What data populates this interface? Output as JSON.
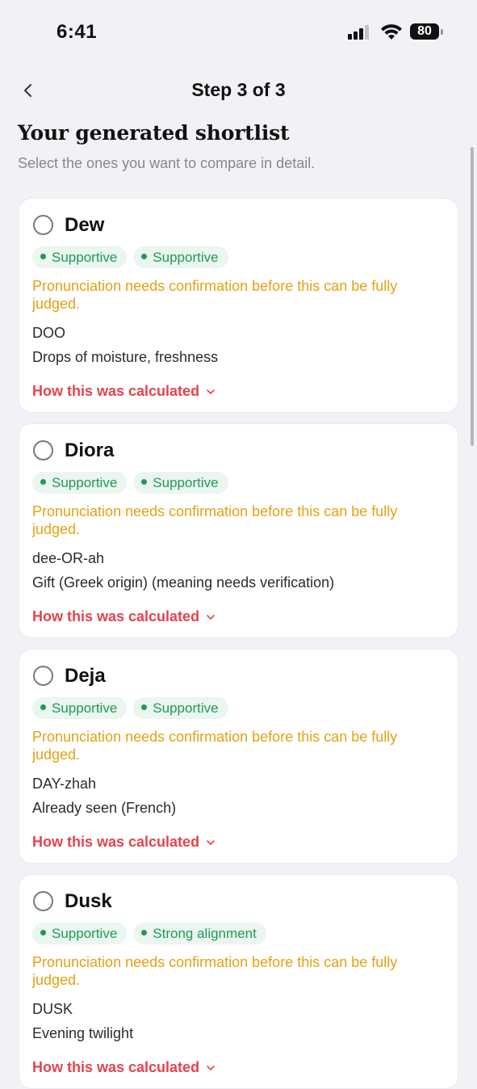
{
  "status_bar": {
    "time": "6:41",
    "battery": "80"
  },
  "header": {
    "step": "Step 3 of 3"
  },
  "page": {
    "title": "Your generated shortlist",
    "subtitle": "Select the ones you want to compare in detail."
  },
  "colors": {
    "accent_red": "#e5434d",
    "warning": "#e5a113",
    "badge_green": "#1f9a57"
  },
  "cards": [
    {
      "name": "Dew",
      "badges": [
        "Supportive",
        "Supportive"
      ],
      "warning": "Pronunciation needs confirmation before this can be fully judged.",
      "pronunciation": "DOO",
      "meaning": "Drops of moisture, freshness",
      "link": "How this was calculated"
    },
    {
      "name": "Diora",
      "badges": [
        "Supportive",
        "Supportive"
      ],
      "warning": "Pronunciation needs confirmation before this can be fully judged.",
      "pronunciation": "dee-OR-ah",
      "meaning": "Gift (Greek origin) (meaning needs verification)",
      "link": "How this was calculated"
    },
    {
      "name": "Deja",
      "badges": [
        "Supportive",
        "Supportive"
      ],
      "warning": "Pronunciation needs confirmation before this can be fully judged.",
      "pronunciation": "DAY-zhah",
      "meaning": "Already seen (French)",
      "link": "How this was calculated"
    },
    {
      "name": "Dusk",
      "badges": [
        "Supportive",
        "Strong alignment"
      ],
      "warning": "Pronunciation needs confirmation before this can be fully judged.",
      "pronunciation": "DUSK",
      "meaning": "Evening twilight",
      "link": "How this was calculated"
    }
  ]
}
